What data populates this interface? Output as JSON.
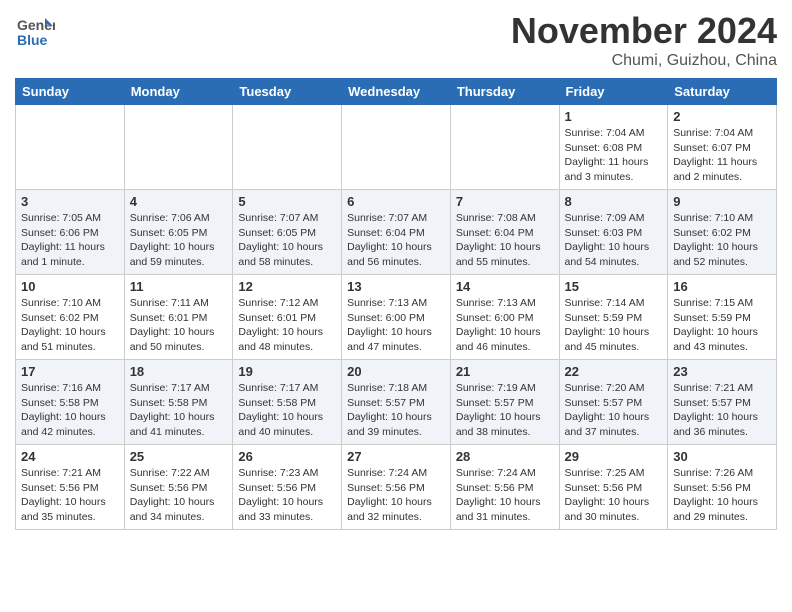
{
  "header": {
    "logo_general": "General",
    "logo_blue": "Blue",
    "month_title": "November 2024",
    "location": "Chumi, Guizhou, China"
  },
  "weekdays": [
    "Sunday",
    "Monday",
    "Tuesday",
    "Wednesday",
    "Thursday",
    "Friday",
    "Saturday"
  ],
  "weeks": [
    [
      {
        "day": "",
        "info": ""
      },
      {
        "day": "",
        "info": ""
      },
      {
        "day": "",
        "info": ""
      },
      {
        "day": "",
        "info": ""
      },
      {
        "day": "",
        "info": ""
      },
      {
        "day": "1",
        "info": "Sunrise: 7:04 AM\nSunset: 6:08 PM\nDaylight: 11 hours\nand 3 minutes."
      },
      {
        "day": "2",
        "info": "Sunrise: 7:04 AM\nSunset: 6:07 PM\nDaylight: 11 hours\nand 2 minutes."
      }
    ],
    [
      {
        "day": "3",
        "info": "Sunrise: 7:05 AM\nSunset: 6:06 PM\nDaylight: 11 hours\nand 1 minute."
      },
      {
        "day": "4",
        "info": "Sunrise: 7:06 AM\nSunset: 6:05 PM\nDaylight: 10 hours\nand 59 minutes."
      },
      {
        "day": "5",
        "info": "Sunrise: 7:07 AM\nSunset: 6:05 PM\nDaylight: 10 hours\nand 58 minutes."
      },
      {
        "day": "6",
        "info": "Sunrise: 7:07 AM\nSunset: 6:04 PM\nDaylight: 10 hours\nand 56 minutes."
      },
      {
        "day": "7",
        "info": "Sunrise: 7:08 AM\nSunset: 6:04 PM\nDaylight: 10 hours\nand 55 minutes."
      },
      {
        "day": "8",
        "info": "Sunrise: 7:09 AM\nSunset: 6:03 PM\nDaylight: 10 hours\nand 54 minutes."
      },
      {
        "day": "9",
        "info": "Sunrise: 7:10 AM\nSunset: 6:02 PM\nDaylight: 10 hours\nand 52 minutes."
      }
    ],
    [
      {
        "day": "10",
        "info": "Sunrise: 7:10 AM\nSunset: 6:02 PM\nDaylight: 10 hours\nand 51 minutes."
      },
      {
        "day": "11",
        "info": "Sunrise: 7:11 AM\nSunset: 6:01 PM\nDaylight: 10 hours\nand 50 minutes."
      },
      {
        "day": "12",
        "info": "Sunrise: 7:12 AM\nSunset: 6:01 PM\nDaylight: 10 hours\nand 48 minutes."
      },
      {
        "day": "13",
        "info": "Sunrise: 7:13 AM\nSunset: 6:00 PM\nDaylight: 10 hours\nand 47 minutes."
      },
      {
        "day": "14",
        "info": "Sunrise: 7:13 AM\nSunset: 6:00 PM\nDaylight: 10 hours\nand 46 minutes."
      },
      {
        "day": "15",
        "info": "Sunrise: 7:14 AM\nSunset: 5:59 PM\nDaylight: 10 hours\nand 45 minutes."
      },
      {
        "day": "16",
        "info": "Sunrise: 7:15 AM\nSunset: 5:59 PM\nDaylight: 10 hours\nand 43 minutes."
      }
    ],
    [
      {
        "day": "17",
        "info": "Sunrise: 7:16 AM\nSunset: 5:58 PM\nDaylight: 10 hours\nand 42 minutes."
      },
      {
        "day": "18",
        "info": "Sunrise: 7:17 AM\nSunset: 5:58 PM\nDaylight: 10 hours\nand 41 minutes."
      },
      {
        "day": "19",
        "info": "Sunrise: 7:17 AM\nSunset: 5:58 PM\nDaylight: 10 hours\nand 40 minutes."
      },
      {
        "day": "20",
        "info": "Sunrise: 7:18 AM\nSunset: 5:57 PM\nDaylight: 10 hours\nand 39 minutes."
      },
      {
        "day": "21",
        "info": "Sunrise: 7:19 AM\nSunset: 5:57 PM\nDaylight: 10 hours\nand 38 minutes."
      },
      {
        "day": "22",
        "info": "Sunrise: 7:20 AM\nSunset: 5:57 PM\nDaylight: 10 hours\nand 37 minutes."
      },
      {
        "day": "23",
        "info": "Sunrise: 7:21 AM\nSunset: 5:57 PM\nDaylight: 10 hours\nand 36 minutes."
      }
    ],
    [
      {
        "day": "24",
        "info": "Sunrise: 7:21 AM\nSunset: 5:56 PM\nDaylight: 10 hours\nand 35 minutes."
      },
      {
        "day": "25",
        "info": "Sunrise: 7:22 AM\nSunset: 5:56 PM\nDaylight: 10 hours\nand 34 minutes."
      },
      {
        "day": "26",
        "info": "Sunrise: 7:23 AM\nSunset: 5:56 PM\nDaylight: 10 hours\nand 33 minutes."
      },
      {
        "day": "27",
        "info": "Sunrise: 7:24 AM\nSunset: 5:56 PM\nDaylight: 10 hours\nand 32 minutes."
      },
      {
        "day": "28",
        "info": "Sunrise: 7:24 AM\nSunset: 5:56 PM\nDaylight: 10 hours\nand 31 minutes."
      },
      {
        "day": "29",
        "info": "Sunrise: 7:25 AM\nSunset: 5:56 PM\nDaylight: 10 hours\nand 30 minutes."
      },
      {
        "day": "30",
        "info": "Sunrise: 7:26 AM\nSunset: 5:56 PM\nDaylight: 10 hours\nand 29 minutes."
      }
    ]
  ]
}
